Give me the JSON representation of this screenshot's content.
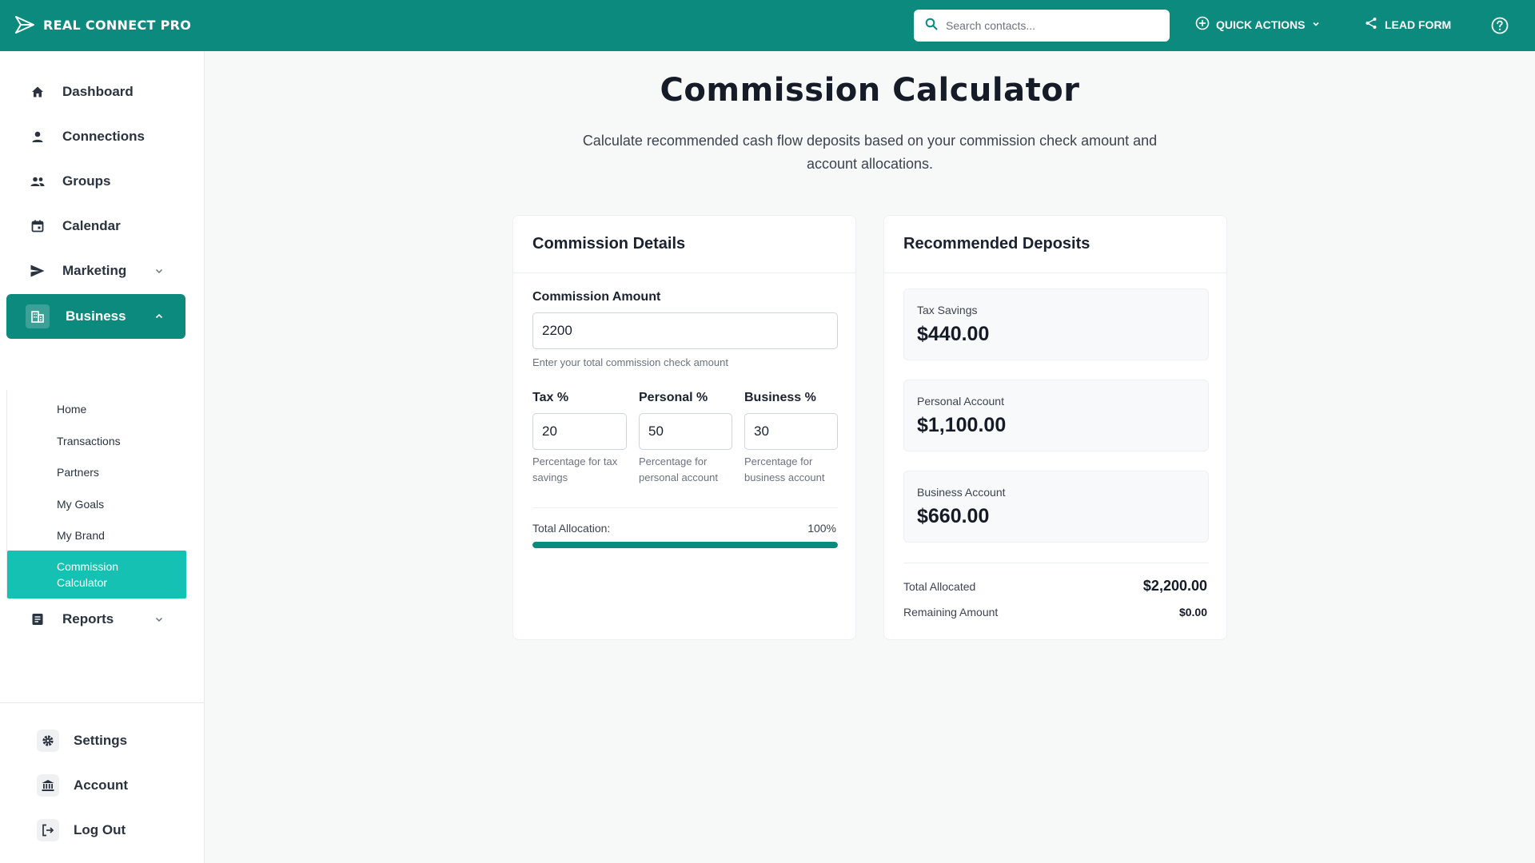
{
  "header": {
    "brand": "REAL CONNECT PRO",
    "search_placeholder": "Search contacts...",
    "quick_actions": "QUICK ACTIONS",
    "lead_form": "LEAD FORM"
  },
  "sidebar": {
    "items": [
      {
        "label": "Dashboard",
        "icon": "home-icon"
      },
      {
        "label": "Connections",
        "icon": "person-icon"
      },
      {
        "label": "Groups",
        "icon": "group-icon"
      },
      {
        "label": "Calendar",
        "icon": "calendar-icon"
      },
      {
        "label": "Marketing",
        "icon": "send-icon"
      },
      {
        "label": "Business",
        "icon": "building-icon"
      },
      {
        "label": "Reports",
        "icon": "document-icon"
      }
    ],
    "business_subitems": [
      "Home",
      "Transactions",
      "Partners",
      "My Goals",
      "My Brand",
      "Commission Calculator"
    ],
    "bottom": [
      {
        "label": "Settings",
        "icon": "gear-icon"
      },
      {
        "label": "Account",
        "icon": "bank-icon"
      },
      {
        "label": "Log Out",
        "icon": "logout-icon"
      }
    ]
  },
  "page": {
    "title": "Commission Calculator",
    "description": "Calculate recommended cash flow deposits based on your commission check amount and account allocations."
  },
  "commission": {
    "title": "Commission Details",
    "amount_label": "Commission Amount",
    "amount_value": "2200",
    "amount_hint": "Enter your total commission check amount",
    "tax_label": "Tax %",
    "tax_value": "20",
    "tax_hint": "Percentage for tax savings",
    "personal_label": "Personal %",
    "personal_value": "50",
    "personal_hint": "Percentage for personal account",
    "business_label": "Business %",
    "business_value": "30",
    "business_hint": "Percentage for business account",
    "total_label": "Total Allocation:",
    "total_value": "100%",
    "total_fraction": 1.0
  },
  "deposits": {
    "title": "Recommended Deposits",
    "tax_label": "Tax Savings",
    "tax_value": "$440.00",
    "personal_label": "Personal Account",
    "personal_value": "$1,100.00",
    "business_label": "Business Account",
    "business_value": "$660.00",
    "total_allocated_label": "Total Allocated",
    "total_allocated_value": "$2,200.00",
    "remaining_label": "Remaining Amount",
    "remaining_value": "$0.00"
  },
  "colors": {
    "brand": "#0b8a7d",
    "active_sub": "#14c1b3"
  }
}
